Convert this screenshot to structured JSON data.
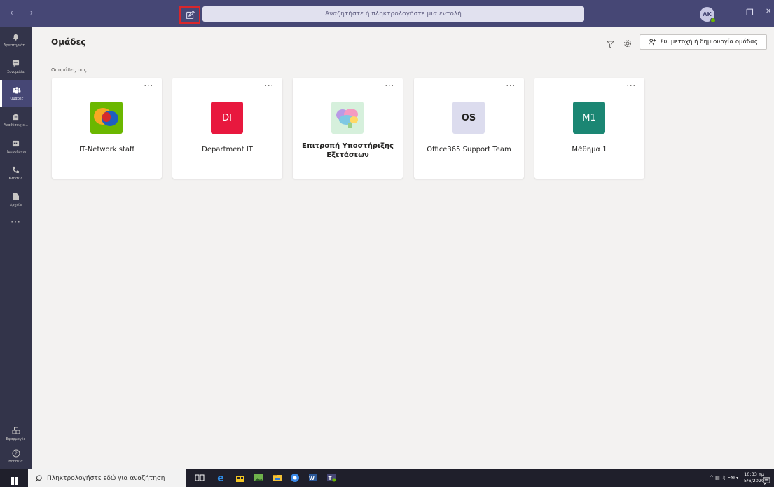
{
  "titlebar": {
    "search_placeholder": "Αναζητήστε ή πληκτρολογήστε μια εντολή",
    "avatar_initials": "AK",
    "minimize": "–",
    "maximize": "❐",
    "close": "✕",
    "back_forward": "‹ ›"
  },
  "rail": {
    "items": [
      {
        "label": "Δραστηριότ...",
        "icon": "bell-icon"
      },
      {
        "label": "Συνομιλία",
        "icon": "chat-icon"
      },
      {
        "label": "Ομάδες",
        "icon": "teams-icon",
        "active": true
      },
      {
        "label": "Αναθέσεις ε...",
        "icon": "assignments-icon"
      },
      {
        "label": "Ημερολόγιο",
        "icon": "calendar-icon"
      },
      {
        "label": "Κλήσεις",
        "icon": "phone-icon"
      },
      {
        "label": "Αρχεία",
        "icon": "file-icon"
      }
    ],
    "more": "···",
    "bottom": [
      {
        "label": "Εφαρμογές",
        "icon": "apps-icon"
      },
      {
        "label": "Βοήθεια",
        "icon": "help-icon"
      }
    ]
  },
  "header": {
    "title": "Ομάδες",
    "join_button": "Συμμετοχή ή δημιουργία ομάδας"
  },
  "section_label": "Οι ομάδες σας",
  "teams": [
    {
      "name": "IT-Network staff",
      "logo": "",
      "color": "#6bb700"
    },
    {
      "name": "Department IT",
      "logo": "DI",
      "color": "#e8183e"
    },
    {
      "name": "Επιτροπή Υποστήριξης Εξετάσεων",
      "logo": "",
      "color": "#d6f0dc"
    },
    {
      "name": "Office365 Support Team",
      "logo": "OS",
      "color": "#dcdcee"
    },
    {
      "name": "Μάθημα 1",
      "logo": "M1",
      "color": "#1b8673"
    }
  ],
  "card_more": "···",
  "taskbar": {
    "search_placeholder": "Πληκτρολογήστε εδώ για αναζήτηση",
    "language": "ENG",
    "time": "10:33 πμ",
    "date": "5/6/2020"
  }
}
